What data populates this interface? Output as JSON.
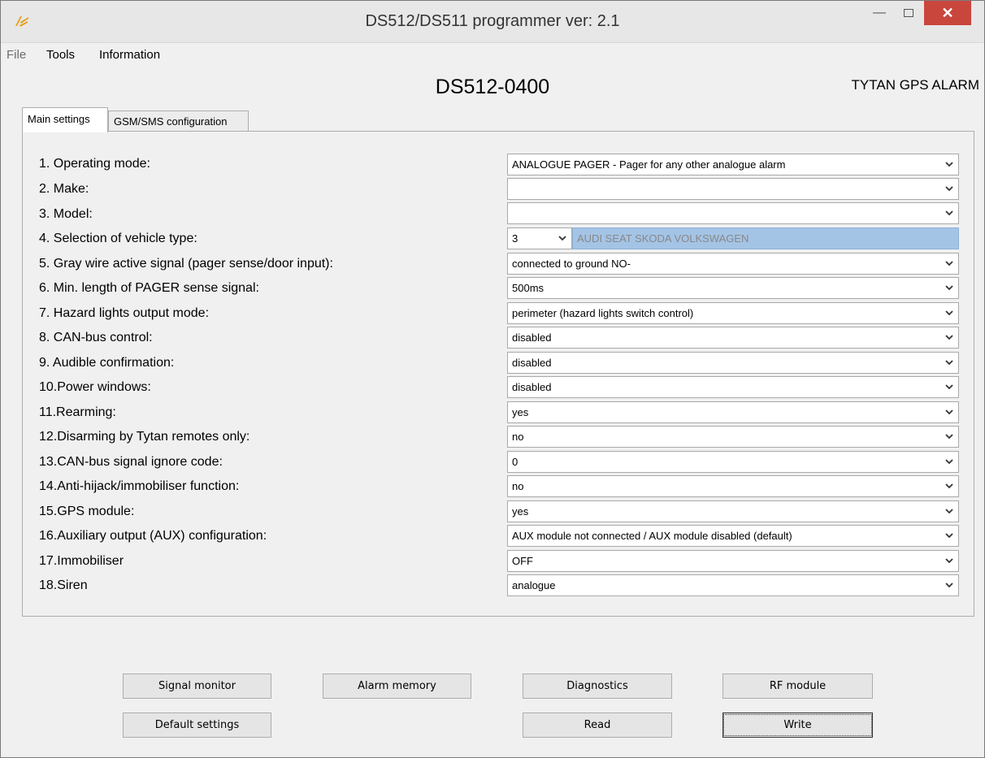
{
  "window": {
    "title": "DS512/DS511 programmer ver:  2.1",
    "icons": {
      "app": "app-logo-icon",
      "minimize": "minimize-icon",
      "maximize": "maximize-icon",
      "close": "close-icon"
    },
    "accent_close": "#c9463d"
  },
  "menu": {
    "file": "File",
    "tools": "Tools",
    "information": "Information"
  },
  "header": {
    "device": "DS512-0400",
    "brand": "TYTAN GPS ALARM"
  },
  "tabs": {
    "main": "Main settings",
    "gsm": "GSM/SMS configuration"
  },
  "settings": [
    {
      "label": "1.  Operating mode:",
      "value": "ANALOGUE PAGER - Pager for any other analogue alarm"
    },
    {
      "label": "2.  Make:",
      "value": ""
    },
    {
      "label": "3.  Model:",
      "value": ""
    },
    {
      "label": "4.  Selection of vehicle type:",
      "value": "3",
      "description": "AUDI SEAT SKODA VOLKSWAGEN"
    },
    {
      "label": "5.  Gray wire active signal (pager sense/door input):",
      "value": "connected to ground NO-"
    },
    {
      "label": "6.  Min. length of PAGER sense signal:",
      "value": "500ms"
    },
    {
      "label": "7.  Hazard lights output mode:",
      "value": "perimeter (hazard lights switch control)"
    },
    {
      "label": "8.  CAN-bus control:",
      "value": "disabled"
    },
    {
      "label": "9.  Audible confirmation:",
      "value": "disabled"
    },
    {
      "label": "10.Power windows:",
      "value": "disabled"
    },
    {
      "label": "11.Rearming:",
      "value": "yes"
    },
    {
      "label": "12.Disarming by Tytan remotes only:",
      "value": "no"
    },
    {
      "label": "13.CAN-bus signal ignore code:",
      "value": "0"
    },
    {
      "label": "14.Anti-hijack/immobiliser function:",
      "value": "no"
    },
    {
      "label": "15.GPS module:",
      "value": "yes"
    },
    {
      "label": "16.Auxiliary output (AUX) configuration:",
      "value": "AUX module not connected / AUX module disabled (default)"
    },
    {
      "label": "17.Immobiliser",
      "value": "OFF"
    },
    {
      "label": "18.Siren",
      "value": "analogue"
    }
  ],
  "buttons": {
    "signal_monitor": "Signal monitor",
    "alarm_memory": "Alarm memory",
    "diagnostics": "Diagnostics",
    "rf_module": "RF module",
    "default_settings": "Default settings",
    "read": "Read",
    "write": "Write"
  }
}
